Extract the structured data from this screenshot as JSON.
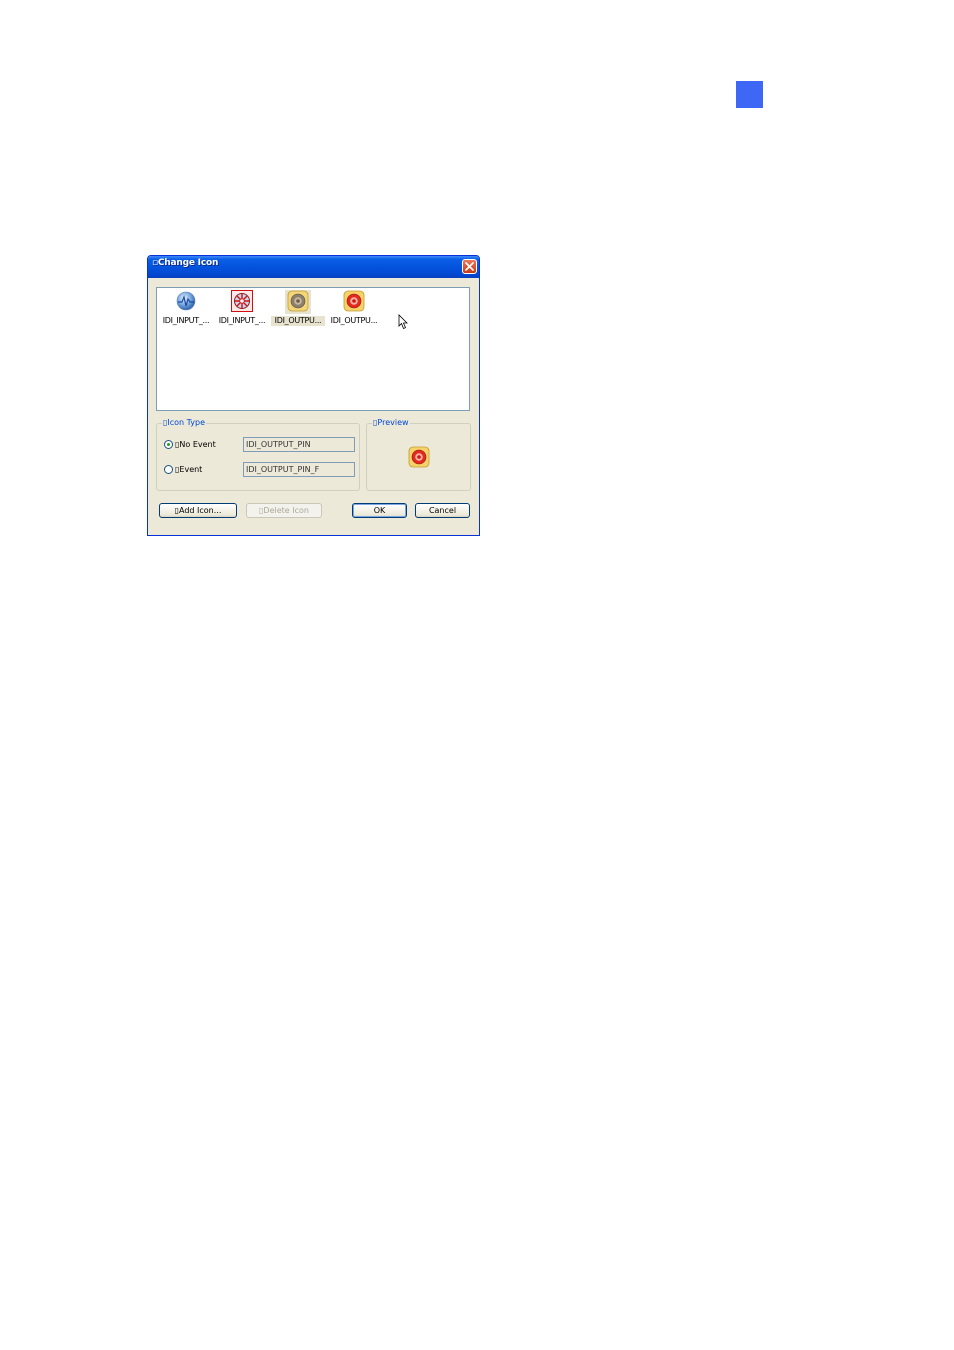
{
  "dialog": {
    "title": "▫Change Icon",
    "close_icon": "close-icon"
  },
  "icon_list": {
    "items": [
      {
        "label": "IDI_INPUT_...",
        "icon": "input-wave-icon",
        "selected": false
      },
      {
        "label": "IDI_INPUT_...",
        "icon": "input-alert-icon",
        "selected": false
      },
      {
        "label": "IDI_OUTPU...",
        "icon": "output-pin-icon",
        "selected": true
      },
      {
        "label": "IDI_OUTPU...",
        "icon": "output-pin-event-icon",
        "selected": false
      }
    ]
  },
  "icon_type": {
    "label": "▯Icon Type",
    "no_event": {
      "label": "▯No Event",
      "value": "IDI_OUTPUT_PIN",
      "checked": true
    },
    "event": {
      "label": "▯Event",
      "value": "IDI_OUTPUT_PIN_F",
      "checked": false
    }
  },
  "preview": {
    "label": "▯Preview",
    "icon": "output-pin-event-icon"
  },
  "buttons": {
    "add_icon": "▯Add Icon...",
    "delete_icon": "▯Delete Icon",
    "ok": "OK",
    "cancel": "Cancel"
  },
  "colors": {
    "accent_square": "#3f67f6",
    "titlebar": "#0453dd",
    "dialog_bg": "#ece9d8"
  }
}
